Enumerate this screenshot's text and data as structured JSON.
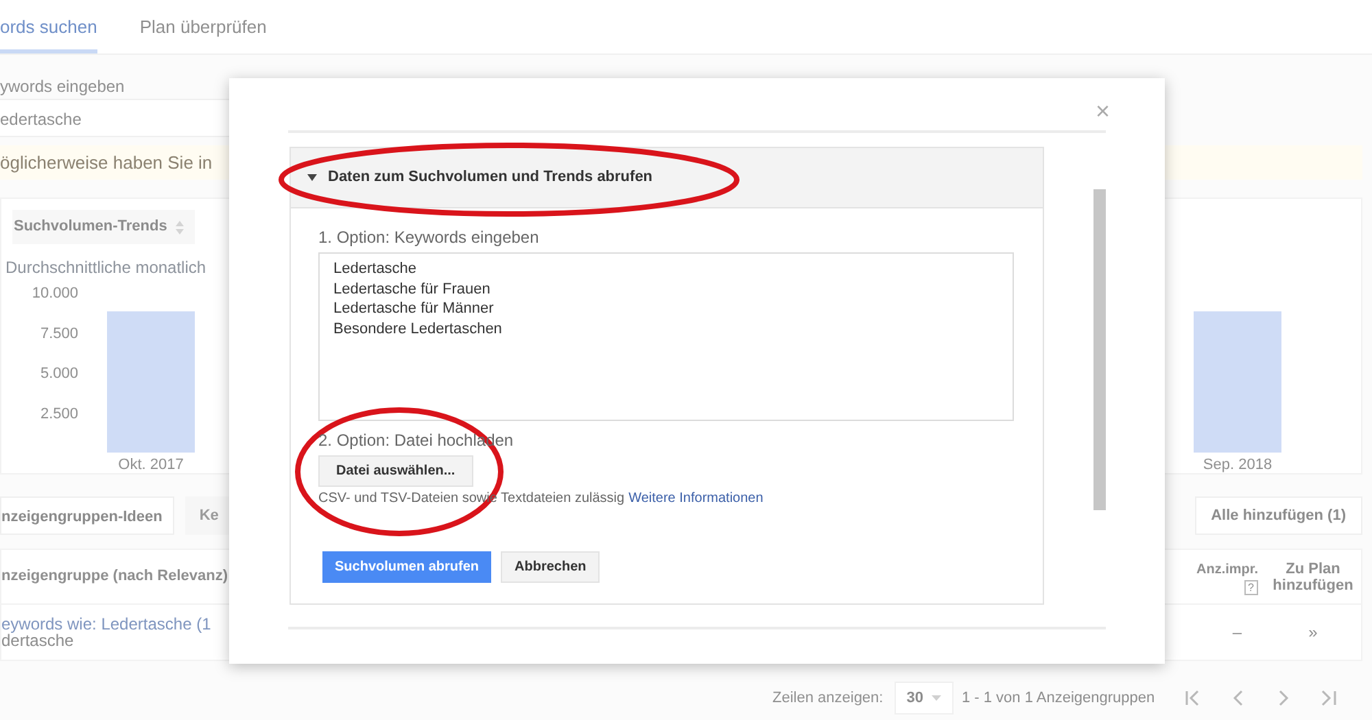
{
  "tabs": [
    {
      "label": "ords suchen",
      "selected": true
    },
    {
      "label": "Plan überprüfen",
      "selected": false
    }
  ],
  "keyword_input": {
    "label": "ywords eingeben",
    "value": "edertasche"
  },
  "warning": "öglicherweise haben Sie in",
  "chart_panel": {
    "dropdown": "Suchvolumen-Trends",
    "chart_data": {
      "type": "bar",
      "title": "Durchschnittliche monatlich",
      "categories": [
        "Okt. 2017",
        null,
        null,
        null,
        null,
        null,
        null,
        null,
        null,
        null,
        null,
        "Sep. 2018"
      ],
      "values": [
        8800,
        null,
        null,
        null,
        null,
        null,
        null,
        null,
        null,
        null,
        null,
        8800
      ],
      "ylim": [
        0,
        10000
      ],
      "yticks": [
        {
          "value": 2500,
          "label": "2.500"
        },
        {
          "value": 5000,
          "label": "5.000"
        },
        {
          "value": 7500,
          "label": "7.500"
        },
        {
          "value": 10000,
          "label": "10.000"
        }
      ]
    }
  },
  "result_tabs": [
    {
      "label": "nzeigengruppen-Ideen",
      "selected": true
    },
    {
      "label": "Ke",
      "selected": false
    }
  ],
  "add_all_button": "Alle hinzufügen (1)",
  "table": {
    "columns": [
      "nzeigengruppe (nach Relevanz)",
      "Anz.impr.",
      "Zu Plan hinzufügen"
    ],
    "help_mark": "?",
    "rows": [
      {
        "lines": [
          "eywords wie: Ledertasche (1",
          "dertasche"
        ],
        "impressions": "–",
        "add": "»"
      }
    ]
  },
  "footer": {
    "rows_label": "Zeilen anzeigen:",
    "rows_value": "30",
    "range": "1 - 1 von 1 Anzeigengruppen"
  },
  "dialog": {
    "close": "×",
    "section": {
      "title": "Daten zum Suchvolumen und Trends abrufen",
      "expanded": true,
      "option1_label": "1. Option: Keywords eingeben",
      "keywords": [
        "Ledertasche",
        "Ledertasche für Frauen",
        "Ledertasche für Männer",
        "Besondere Ledertaschen"
      ],
      "option2_label": "2. Option: Datei hochladen",
      "file_button": "Datei auswählen...",
      "help": "CSV- und TSV-Dateien sowie Textdateien zulässig",
      "help_link": "Weitere Informationen",
      "primary_button": "Suchvolumen abrufen",
      "cancel_button": "Abbrechen"
    }
  }
}
